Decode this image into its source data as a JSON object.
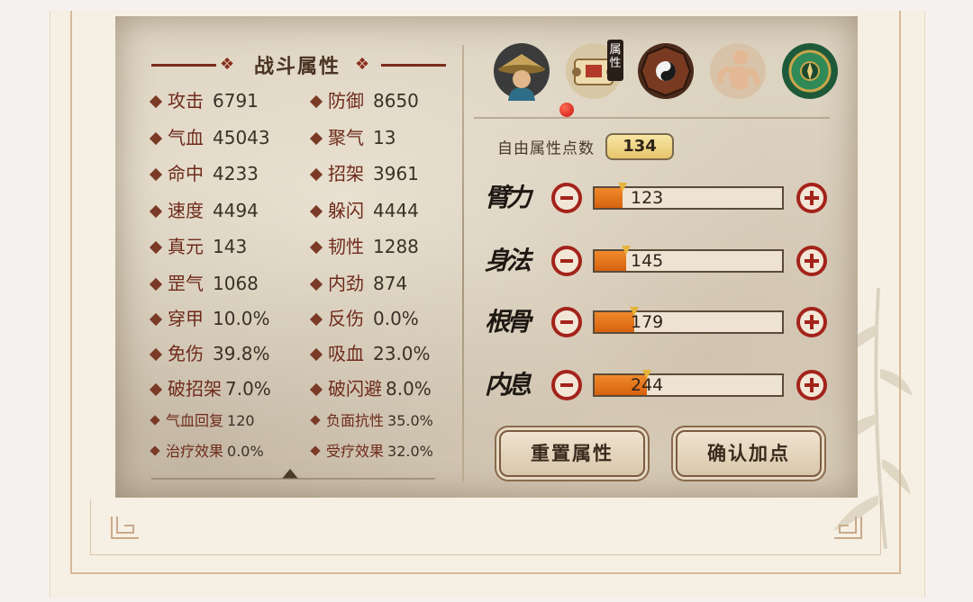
{
  "panel": {
    "title": "战斗属性",
    "stats_left": [
      {
        "label": "攻击",
        "value": "6791"
      },
      {
        "label": "气血",
        "value": "45043"
      },
      {
        "label": "命中",
        "value": "4233"
      },
      {
        "label": "速度",
        "value": "4494"
      },
      {
        "label": "真元",
        "value": "143"
      },
      {
        "label": "罡气",
        "value": "1068"
      },
      {
        "label": "穿甲",
        "value": "10.0%"
      },
      {
        "label": "免伤",
        "value": "39.8%"
      },
      {
        "label": "破招架",
        "value": "7.0%"
      },
      {
        "label": "气血回复",
        "value": "120"
      },
      {
        "label": "治疗效果",
        "value": "0.0%"
      }
    ],
    "stats_right": [
      {
        "label": "防御",
        "value": "8650"
      },
      {
        "label": "聚气",
        "value": "13"
      },
      {
        "label": "招架",
        "value": "3961"
      },
      {
        "label": "躲闪",
        "value": "4444"
      },
      {
        "label": "韧性",
        "value": "1288"
      },
      {
        "label": "内劲",
        "value": "874"
      },
      {
        "label": "反伤",
        "value": "0.0%"
      },
      {
        "label": "吸血",
        "value": "23.0%"
      },
      {
        "label": "破闪避",
        "value": "8.0%"
      },
      {
        "label": "负面抗性",
        "value": "35.0%"
      },
      {
        "label": "受疗效果",
        "value": "32.0%"
      }
    ]
  },
  "tabs": {
    "items": [
      {
        "icon": "character-hat-icon"
      },
      {
        "icon": "scroll-attribute-icon",
        "tag": "属性"
      },
      {
        "icon": "bagua-icon"
      },
      {
        "icon": "meridian-body-icon"
      },
      {
        "icon": "jade-compass-icon"
      }
    ]
  },
  "attributes": {
    "free_points_label": "自由属性点数",
    "free_points": "134",
    "items": [
      {
        "name": "臂力",
        "value": "123",
        "fill": 0.15
      },
      {
        "name": "身法",
        "value": "145",
        "fill": 0.17
      },
      {
        "name": "根骨",
        "value": "179",
        "fill": 0.21
      },
      {
        "name": "内息",
        "value": "244",
        "fill": 0.28
      }
    ]
  },
  "buttons": {
    "reset": "重置属性",
    "confirm": "确认加点"
  },
  "colors": {
    "accent_red": "#a3231a",
    "bar_orange": "#e8751c",
    "parchment": "#ddd3c1"
  }
}
